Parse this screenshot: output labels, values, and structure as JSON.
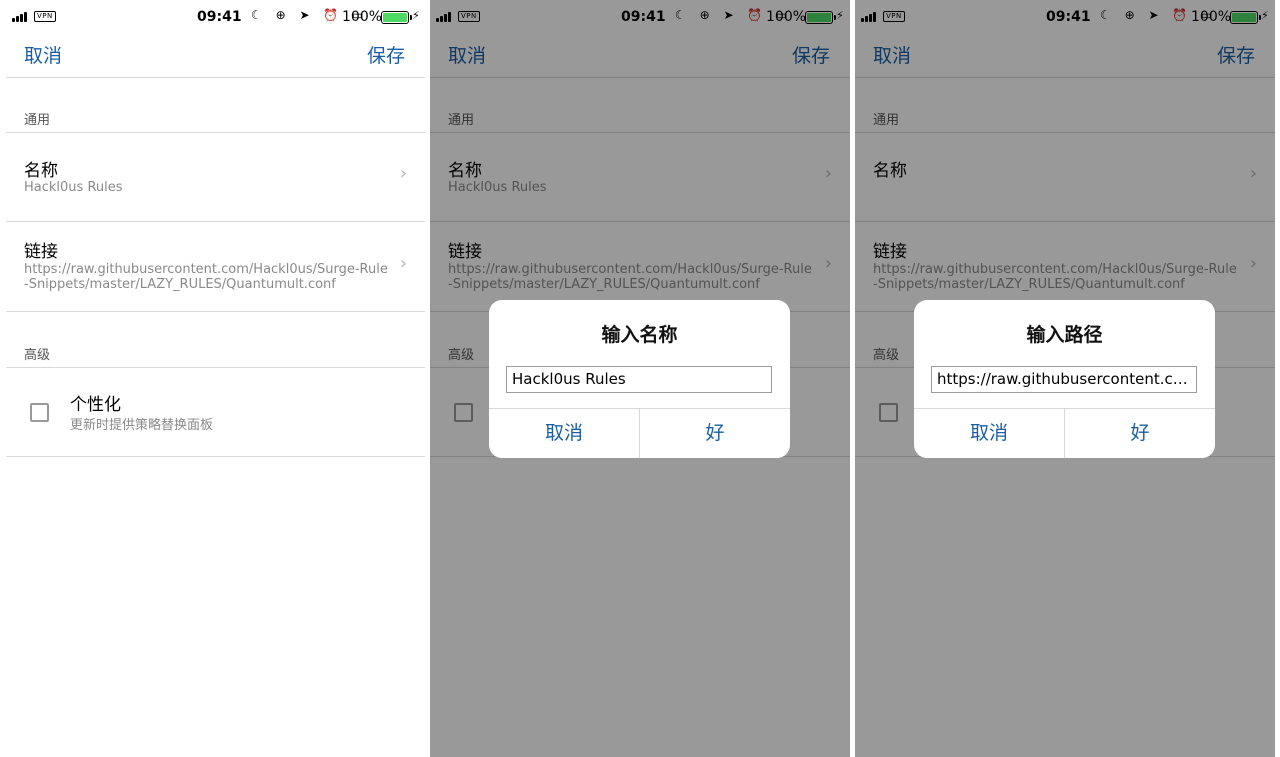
{
  "status": {
    "carrier_badge": "VPN",
    "time": "09:41",
    "status_icons": "☾ ⊕ ➤ ⏰ ▭",
    "battery_percent": "100%",
    "battery_level": 1.0,
    "battery_color": "#4cd964"
  },
  "nav": {
    "cancel": "取消",
    "save": "保存"
  },
  "sections": {
    "general": "通用",
    "advanced": "高级"
  },
  "rows": {
    "name_title": "名称",
    "name_value": "Hackl0us Rules",
    "link_title": "链接",
    "link_value_line1": "https://raw.githubusercontent.com/Hackl0us/Surge-Rule",
    "link_value_line2": "-Snippets/master/LAZY_RULES/Quantumult.conf",
    "chevron": "›"
  },
  "option": {
    "title": "个性化",
    "subtitle": "更新时提供策略替换面板",
    "checked": false
  },
  "dialog_name": {
    "title": "输入名称",
    "input_value": "Hackl0us Rules",
    "cancel": "取消",
    "ok": "好"
  },
  "dialog_path": {
    "title": "输入路径",
    "input_value": "https://raw.githubusercontent.com/...",
    "cancel": "取消",
    "ok": "好"
  },
  "colors": {
    "accent": "#1a5fa6",
    "overlay": "rgba(0,0,0,0.4)"
  }
}
